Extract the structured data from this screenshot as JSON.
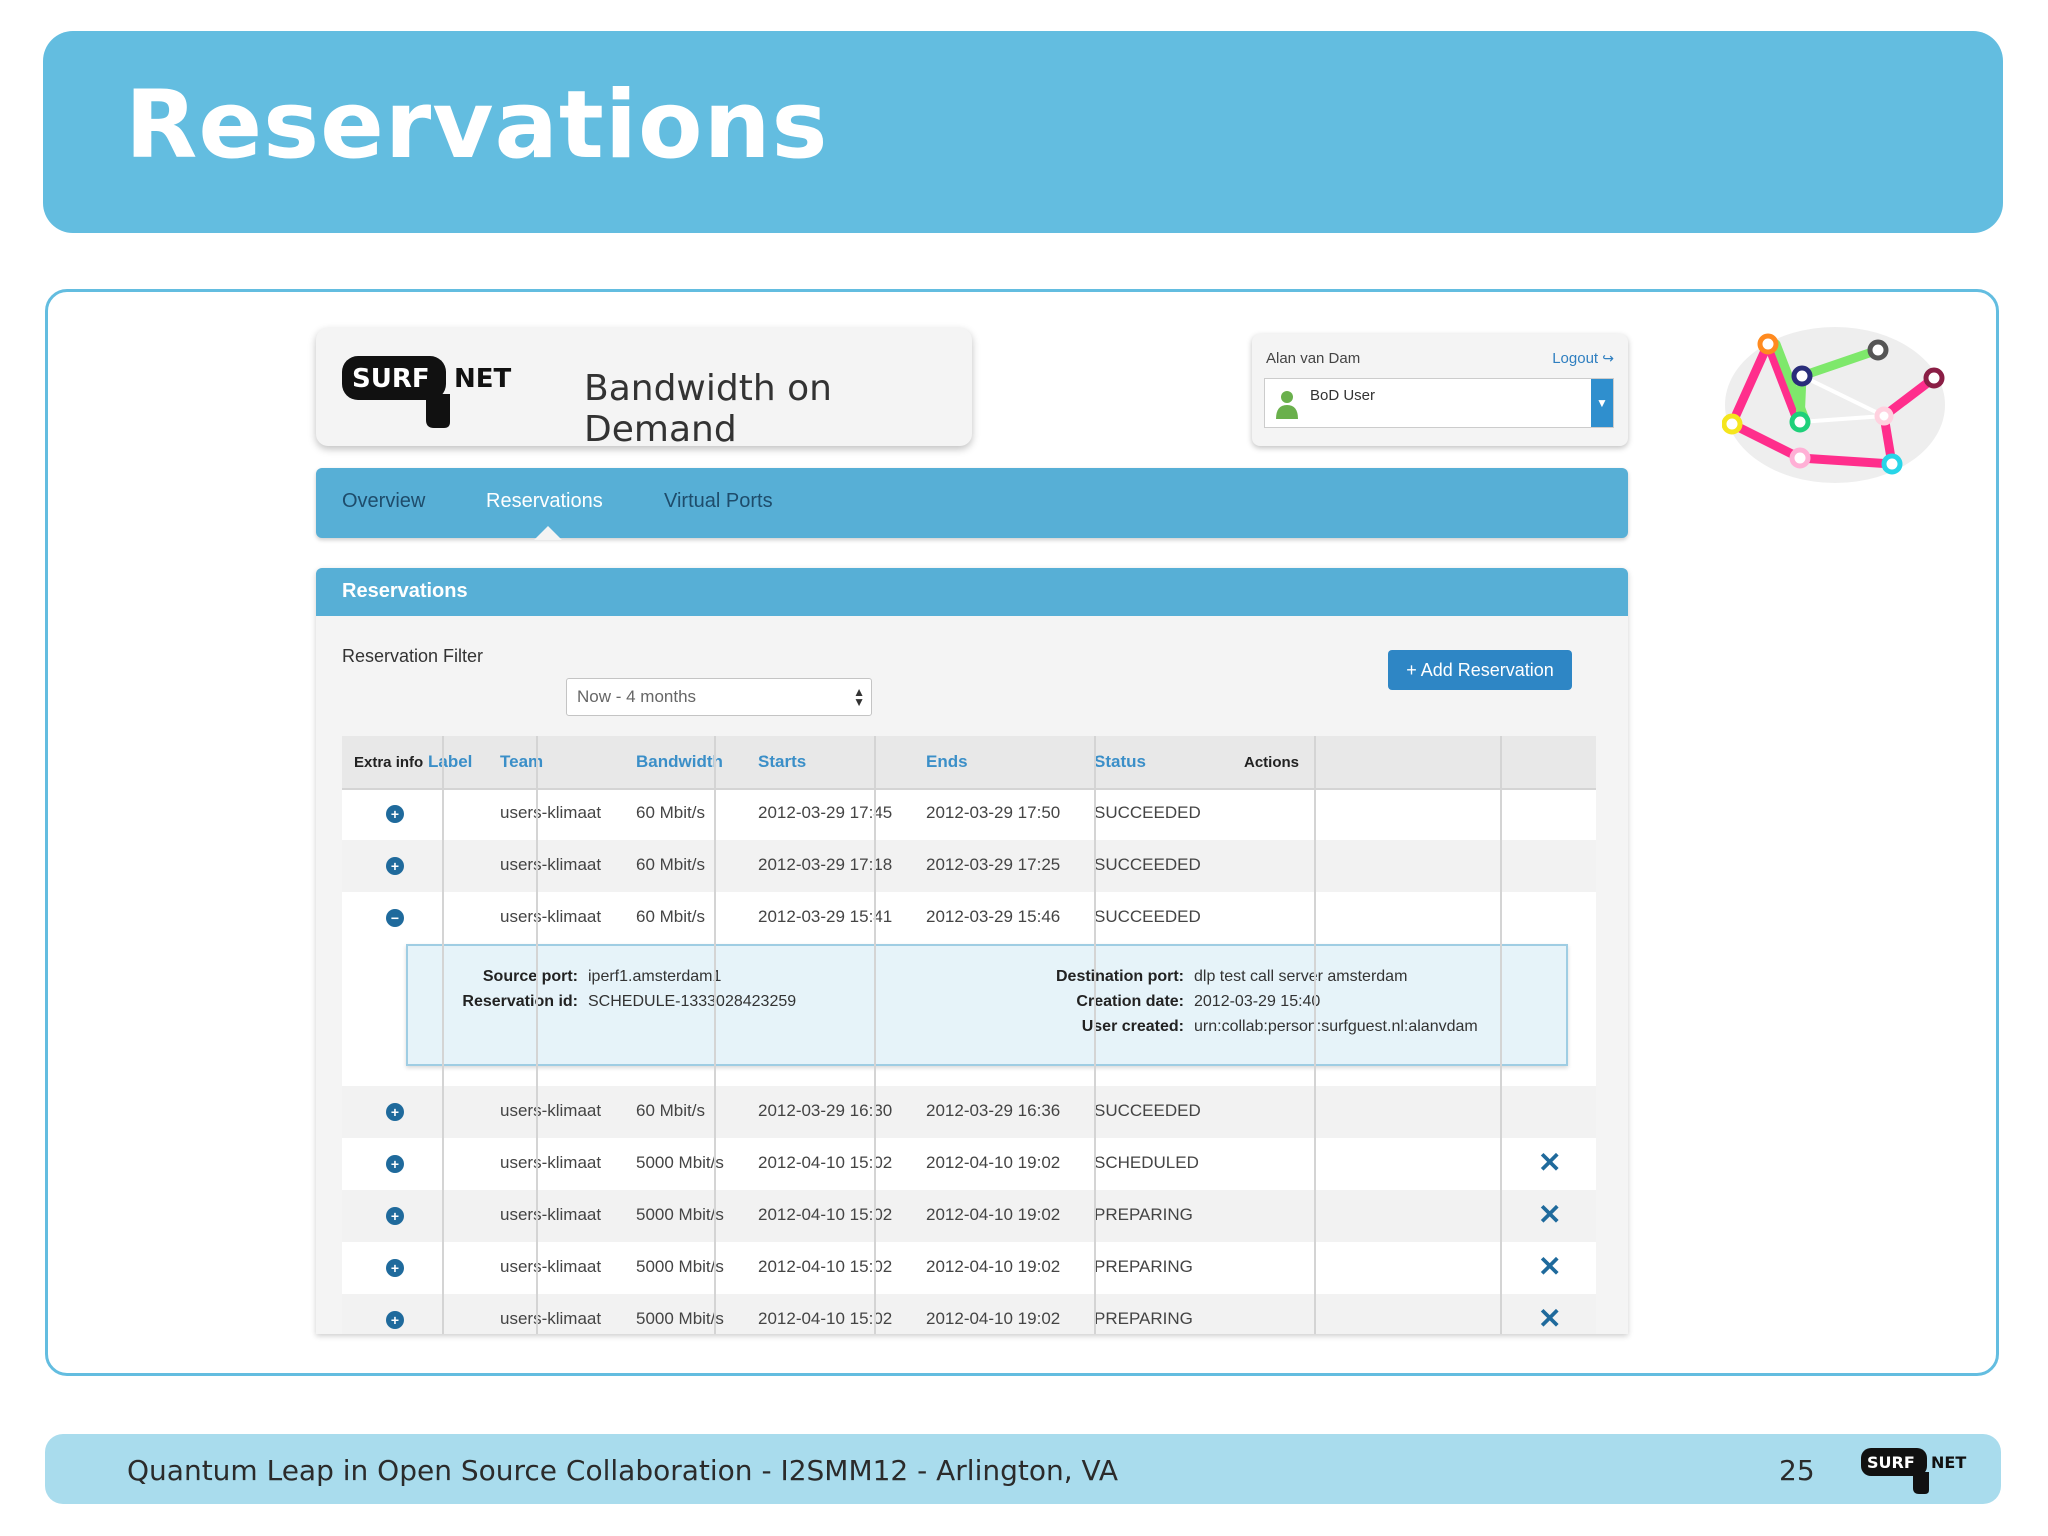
{
  "slide": {
    "title": "Reservations",
    "footer": "Quantum Leap in Open Source Collaboration - I2SMM12 - Arlington, VA",
    "page_number": "25"
  },
  "brand": {
    "logo_left": "SURF",
    "logo_right": "NET",
    "app_title": "Bandwidth on Demand"
  },
  "user": {
    "name": "Alan van Dam",
    "logout": "Logout",
    "role": "BoD User",
    "role_icon": "user-icon"
  },
  "nav": {
    "items": [
      "Overview",
      "Reservations",
      "Virtual Ports"
    ],
    "active": "Reservations"
  },
  "panel": {
    "title": "Reservations",
    "filter_label": "Reservation Filter",
    "filter_value": "Now - 4 months",
    "add_button": "+ Add Reservation"
  },
  "table": {
    "headers": [
      "Extra info",
      "Label",
      "Team",
      "Bandwidth",
      "Starts",
      "Ends",
      "Status",
      "Actions"
    ],
    "rows": [
      {
        "team": "users-klimaat",
        "bandwidth": "60 Mbit/s",
        "starts": "2012-03-29 17:45",
        "ends": "2012-03-29 17:50",
        "status": "SUCCEEDED"
      },
      {
        "team": "users-klimaat",
        "bandwidth": "60 Mbit/s",
        "starts": "2012-03-29 17:18",
        "ends": "2012-03-29 17:25",
        "status": "SUCCEEDED"
      },
      {
        "team": "users-klimaat",
        "bandwidth": "60 Mbit/s",
        "starts": "2012-03-29 15:41",
        "ends": "2012-03-29 15:46",
        "status": "SUCCEEDED"
      },
      {
        "team": "users-klimaat",
        "bandwidth": "60 Mbit/s",
        "starts": "2012-03-29 16:30",
        "ends": "2012-03-29 16:36",
        "status": "SUCCEEDED"
      },
      {
        "team": "users-klimaat",
        "bandwidth": "5000 Mbit/s",
        "starts": "2012-04-10 15:02",
        "ends": "2012-04-10 19:02",
        "status": "SCHEDULED"
      },
      {
        "team": "users-klimaat",
        "bandwidth": "5000 Mbit/s",
        "starts": "2012-04-10 15:02",
        "ends": "2012-04-10 19:02",
        "status": "PREPARING"
      },
      {
        "team": "users-klimaat",
        "bandwidth": "5000 Mbit/s",
        "starts": "2012-04-10 15:02",
        "ends": "2012-04-10 19:02",
        "status": "PREPARING"
      },
      {
        "team": "users-klimaat",
        "bandwidth": "5000 Mbit/s",
        "starts": "2012-04-10 15:02",
        "ends": "2012-04-10 19:02",
        "status": "PREPARING"
      }
    ],
    "details": {
      "source_port_label": "Source port:",
      "source_port": "iperf1.amsterdam1",
      "reservation_id_label": "Reservation id:",
      "reservation_id": "SCHEDULE-1333028423259",
      "destination_port_label": "Destination port:",
      "destination_port": "dlp test call server amsterdam",
      "creation_date_label": "Creation date:",
      "creation_date": "2012-03-29 15:40",
      "user_created_label": "User created:",
      "user_created": "urn:collab:person:surfguest.nl:alanvdam"
    }
  },
  "colors": {
    "accent": "#63bde0",
    "nav_blue": "#57afd6",
    "button_blue": "#2e86c5",
    "icon_blue": "#1f6a9c",
    "footer_bg": "#a9dced"
  }
}
